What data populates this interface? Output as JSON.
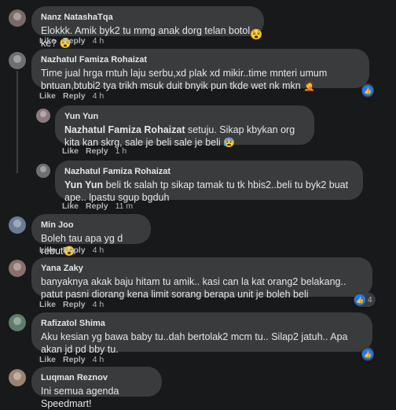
{
  "comments": [
    {
      "name": "Nanz NatashaTqa",
      "text": "Elokkk. Amik byk2 tu mmg anak dorg telan botol ke?",
      "emoji": "😵",
      "like": "Like",
      "reply": "Reply",
      "time": "4 h"
    },
    {
      "name": "Nazhatul Famiza Rohaizat",
      "text": "Time jual hrga rntuh laju serbu,xd plak xd mikir..time mnteri umum bntuan,btubi2 tya trikh msuk duit bnyik pun tkde wet nk mkn",
      "emoji": "🤦",
      "like": "Like",
      "reply": "Reply",
      "time": "4 h"
    },
    {
      "name": "Yun Yun",
      "mention": "Nazhatul Famiza Rohaizat",
      "text": " setuju. Sikap kbykan org kita kan skrg, sale je beli sale je beli",
      "emoji": "😰",
      "like": "Like",
      "reply": "Reply",
      "time": "1 h"
    },
    {
      "name": "Nazhatul Famiza Rohaizat",
      "mention": "Yun Yun",
      "text": " beli tk salah tp sikap tamak tu tk hbis2..beli tu byk2 buat ape.. lpastu sgup bgduh",
      "like": "Like",
      "reply": "Reply",
      "time": "11 m"
    },
    {
      "name": "Min Joo",
      "text": "Boleh tau apa yg d rebut",
      "emoji": "😮",
      "like": "Like",
      "reply": "Reply",
      "time": "4 h"
    },
    {
      "name": "Yana Zaky",
      "text": "banyaknya akak baju hitam tu amik.. kasi can la kat orang2 belakang.. patut pasni diorang kena limit sorang berapa unit je boleh beli",
      "like": "Like",
      "reply": "Reply",
      "time": "4 h",
      "reactions": "4"
    },
    {
      "name": "Rafizatol Shima",
      "text": "Aku kesian yg bawa baby tu..dah bertolak2 mcm tu.. Silap2 jatuh.. Apa akan jd pd bby tu.",
      "like": "Like",
      "reply": "Reply",
      "time": "4 h"
    },
    {
      "name": "Luqman Reznov",
      "text": "Ini semua agenda Speedmart!"
    }
  ],
  "icons": {
    "like_reaction": "thumbs-up-icon",
    "avatar": "avatar-icon"
  },
  "colors": {
    "background": "#18191a",
    "bubble": "#3a3b3c",
    "like_blue": "#2078f4"
  }
}
